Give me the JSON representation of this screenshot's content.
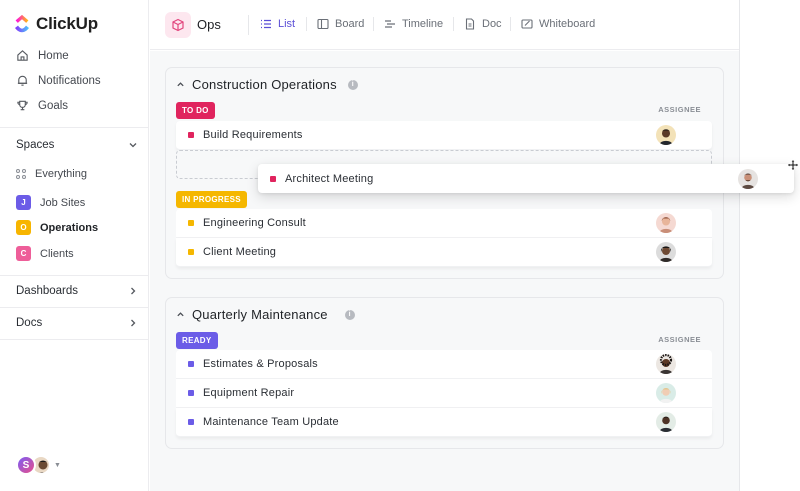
{
  "brand": {
    "name": "ClickUp"
  },
  "sidebar": {
    "nav": [
      {
        "label": "Home",
        "icon": "home-icon"
      },
      {
        "label": "Notifications",
        "icon": "bell-icon"
      },
      {
        "label": "Goals",
        "icon": "trophy-icon"
      }
    ],
    "spaces_label": "Spaces",
    "everything_label": "Everything",
    "spaces": [
      {
        "letter": "J",
        "label": "Job Sites",
        "color": "#6c5ce7"
      },
      {
        "letter": "O",
        "label": "Operations",
        "color": "#f7b500"
      },
      {
        "letter": "C",
        "label": "Clients",
        "color": "#ee5e99"
      }
    ],
    "dashboards_label": "Dashboards",
    "docs_label": "Docs",
    "user_initial": "S"
  },
  "topbar": {
    "space_name": "Ops",
    "views": [
      {
        "label": "List",
        "icon": "list-icon",
        "active": true
      },
      {
        "label": "Board",
        "icon": "board-icon"
      },
      {
        "label": "Timeline",
        "icon": "timeline-icon"
      },
      {
        "label": "Doc",
        "icon": "doc-icon"
      },
      {
        "label": "Whiteboard",
        "icon": "whiteboard-icon"
      }
    ]
  },
  "lists": [
    {
      "title": "Construction Operations",
      "assignee_label": "ASSIGNEE",
      "groups": [
        {
          "status": "TO DO",
          "color": "#e0245e",
          "tasks": [
            {
              "name": "Build Requirements"
            }
          ]
        },
        {
          "status": "IN PROGRESS",
          "color": "#f5b700",
          "tasks": [
            {
              "name": "Engineering Consult"
            },
            {
              "name": "Client Meeting"
            }
          ]
        }
      ]
    },
    {
      "title": "Quarterly Maintenance",
      "assignee_label": "ASSIGNEE",
      "groups": [
        {
          "status": "READY",
          "color": "#6b5ce7",
          "tasks": [
            {
              "name": "Estimates & Proposals"
            },
            {
              "name": "Equipment Repair"
            },
            {
              "name": "Maintenance Team Update"
            }
          ]
        }
      ]
    }
  ],
  "dragging_task": {
    "name": "Architect Meeting",
    "color": "#e0245e"
  }
}
